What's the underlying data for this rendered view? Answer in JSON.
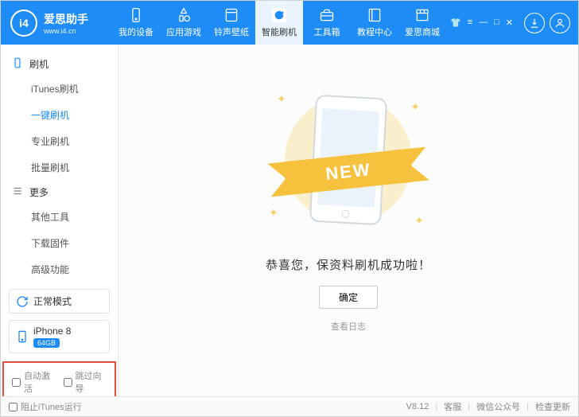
{
  "brand": {
    "name": "爱思助手",
    "url": "www.i4.cn",
    "logo_text": "i4"
  },
  "topnav": [
    {
      "label": "我的设备",
      "icon": "device"
    },
    {
      "label": "应用游戏",
      "icon": "app"
    },
    {
      "label": "铃声壁纸",
      "icon": "music"
    },
    {
      "label": "智能刷机",
      "icon": "refresh",
      "active": true
    },
    {
      "label": "工具箱",
      "icon": "toolbox"
    },
    {
      "label": "教程中心",
      "icon": "book"
    },
    {
      "label": "爱思商城",
      "icon": "shop"
    }
  ],
  "sidebar": {
    "sections": [
      {
        "title": "刷机",
        "icon": "phone-outline",
        "key": "sec0",
        "items": [
          "iTunes刷机",
          "一键刷机",
          "专业刷机",
          "批量刷机"
        ],
        "active_index": 1
      },
      {
        "title": "更多",
        "icon": "list",
        "key": "sec1",
        "items": [
          "其他工具",
          "下载固件",
          "高级功能"
        ],
        "active_index": -1
      }
    ],
    "mode_card": {
      "label": "正常模式"
    },
    "device_card": {
      "name": "iPhone 8",
      "storage": "64GB"
    },
    "footer_checks": {
      "auto_activate": "自动激活",
      "skip_guide": "跳过向导"
    }
  },
  "content": {
    "ribbon": "NEW",
    "success_text": "恭喜您，保资料刷机成功啦！",
    "ok_button": "确定",
    "log_link": "查看日志"
  },
  "statusbar": {
    "block_itunes": "阻止iTunes运行",
    "version": "V8.12",
    "support": "客服",
    "wechat": "微信公众号",
    "check_update": "检查更新"
  }
}
